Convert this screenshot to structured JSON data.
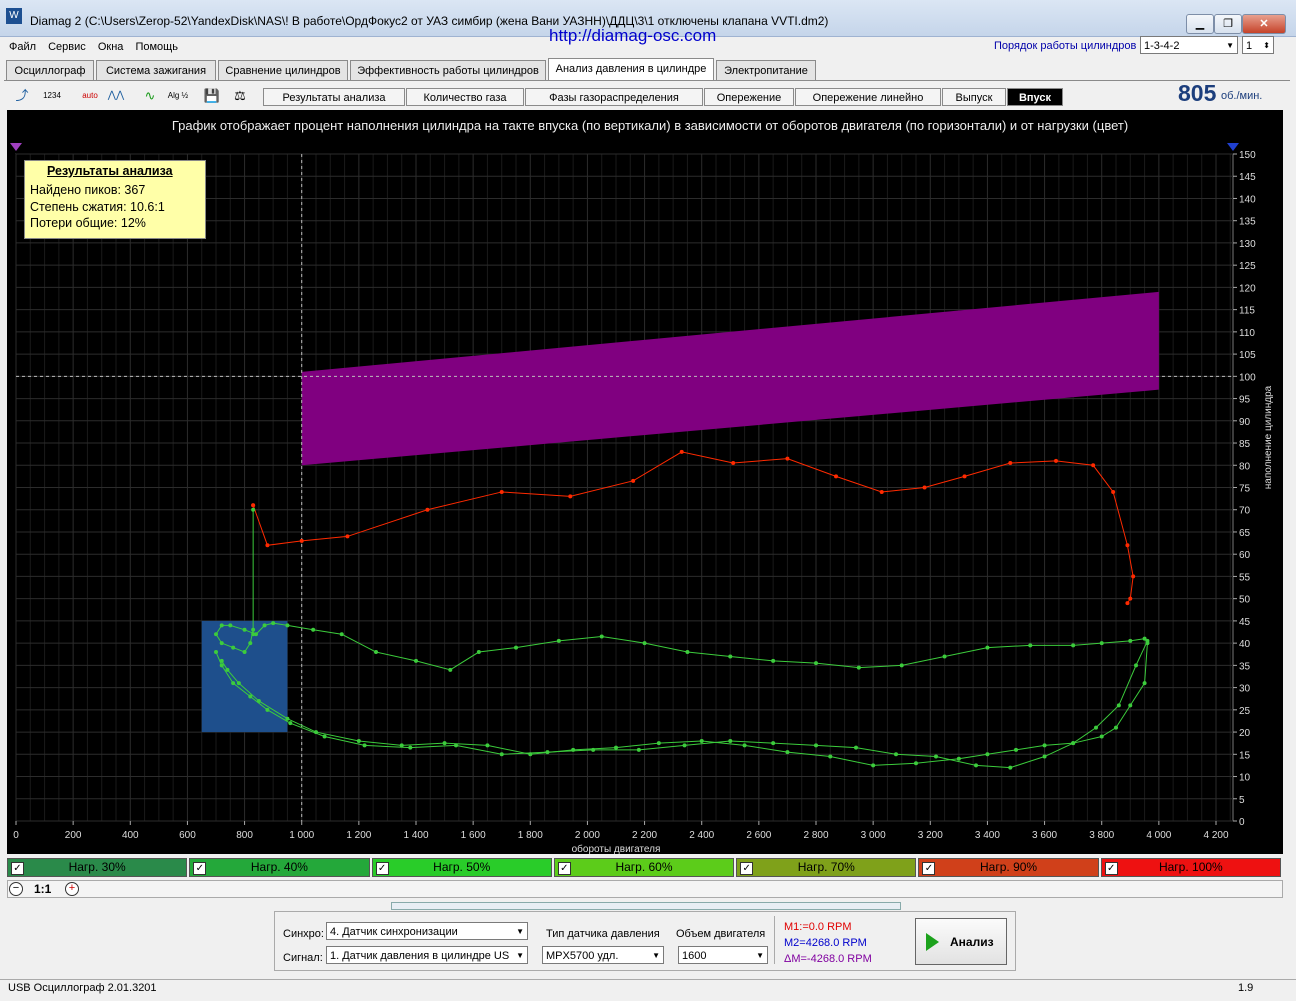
{
  "window": {
    "title": "Diamag 2 (C:\\Users\\Zerop-52\\YandexDisk\\NAS\\! В работе\\ОрдФокус2 от УАЗ симбир (жена Вани УАЗНН)\\ДДЦ\\3\\1 отключены клапана VVTI.dm2)",
    "app_icon": "W",
    "min": "▁",
    "max": "❐",
    "close": "✕"
  },
  "menu": [
    "Файл",
    "Сервис",
    "Окна",
    "Помощь"
  ],
  "site_url": "http://diamag-osc.com",
  "cylinder_order": {
    "label": "Порядок работы цилиндров",
    "value": "1-3-4-2",
    "spin_value": "1"
  },
  "tabs": [
    "Осциллограф",
    "Система зажигания",
    "Сравнение цилиндров",
    "Эффективность работы цилиндров",
    "Анализ давления в цилиндре",
    "Электропитание"
  ],
  "active_tab": "Анализ давления в цилиндре",
  "toolbar_icons": [
    "cursor-icon",
    "counter-icon",
    "auto-icon",
    "waveform-icon",
    "graph-icon",
    "alg-half-icon",
    "save-icon",
    "scale-icon"
  ],
  "toolbar_glyphs": [
    "⤴",
    "1234",
    "auto",
    "⋀⋀",
    "∿",
    "Alg ½",
    "💾",
    "⚖"
  ],
  "subtabs": [
    "Результаты анализа",
    "Количество газа",
    "Фазы газораспределения",
    "Опережение",
    "Опережение линейно",
    "Выпуск",
    "Впуск"
  ],
  "active_subtab": "Впуск",
  "rpm": {
    "value": "805",
    "unit": "об./мин."
  },
  "chart_data": {
    "type": "scatter",
    "title": "График отображает процент наполнения цилиндра на такте впуска (по вертикали) в зависимости от оборотов двигателя (по горизонтали) и от нагрузки (цвет)",
    "xlabel": "обороты двигателя",
    "ylabel": "наполнение цилиндра",
    "xlim": [
      0,
      4400
    ],
    "ylim": [
      0,
      150
    ],
    "x_ticks": [
      "0",
      "200",
      "400",
      "600",
      "800",
      "1 000",
      "1 200",
      "1 400",
      "1 600",
      "1 800",
      "2 000",
      "2 200",
      "2 400",
      "2 600",
      "2 800",
      "3 000",
      "3 200",
      "3 400",
      "3 600",
      "3 800",
      "4 000",
      "4 200"
    ],
    "x_tick_values": [
      0,
      200,
      400,
      600,
      800,
      1000,
      1200,
      1400,
      1600,
      1800,
      2000,
      2200,
      2400,
      2600,
      2800,
      3000,
      3200,
      3400,
      3600,
      3800,
      4000,
      4200
    ],
    "y_ticks": [
      0,
      5,
      10,
      15,
      20,
      25,
      30,
      35,
      40,
      45,
      50,
      55,
      60,
      65,
      70,
      75,
      80,
      85,
      90,
      95,
      100,
      105,
      110,
      115,
      120,
      125,
      130,
      135,
      140,
      145,
      150
    ],
    "reference_line_y": 100,
    "reference_line_x": 1000,
    "norm_band": {
      "x": [
        1000,
        4000
      ],
      "lower": [
        80,
        97
      ],
      "upper": [
        101,
        119
      ],
      "color": "#800080"
    },
    "idle_zone": {
      "x": [
        650,
        950
      ],
      "y": [
        20,
        45
      ],
      "color": "#1e4f8c"
    },
    "series": [
      {
        "color": "#ff2a00",
        "x": [
          830,
          830,
          880,
          1000,
          1160,
          1440,
          1700,
          1940,
          2160,
          2330,
          2510,
          2700,
          2870,
          3030,
          3180,
          3320,
          3480,
          3640,
          3770,
          3840,
          3890,
          3910,
          3900,
          3890
        ],
        "y": [
          71,
          71,
          62,
          63,
          64,
          70,
          74,
          73,
          76.5,
          83,
          80.5,
          81.5,
          77.5,
          74,
          75,
          77.5,
          80.5,
          81,
          80,
          74,
          62,
          55,
          50,
          49
        ]
      },
      {
        "color": "#3ccc3c",
        "x": [
          830,
          820,
          800,
          760,
          720,
          700,
          720,
          750,
          800,
          840,
          870,
          900,
          950,
          1040,
          1140,
          1260,
          1400,
          1520,
          1620,
          1750,
          1900,
          2050,
          2200,
          2350,
          2500,
          2650,
          2800,
          2950,
          3100,
          3250,
          3400,
          3550,
          3700,
          3800,
          3900,
          3950,
          3960,
          3950,
          3900,
          3850,
          3800,
          3700,
          3600,
          3500,
          3400,
          3300,
          3150,
          3000,
          2850,
          2700,
          2550,
          2400,
          2250,
          2100,
          1950,
          1800,
          1650,
          1500,
          1350,
          1200,
          1050,
          950,
          850,
          780,
          740,
          720
        ],
        "y": [
          43,
          40,
          38,
          39,
          40,
          42,
          44,
          44,
          43,
          42,
          44,
          44.5,
          44,
          43,
          42,
          38,
          36,
          34,
          38,
          39,
          40.5,
          41.5,
          40,
          38,
          37,
          36,
          35.5,
          34.5,
          35,
          37,
          39,
          39.5,
          39.5,
          40,
          40.5,
          41,
          40,
          31,
          26,
          21,
          19,
          17.5,
          17,
          16,
          15,
          14,
          13,
          12.5,
          14.5,
          15.5,
          17,
          18,
          17.5,
          16.5,
          16,
          15,
          17,
          17.5,
          17,
          18,
          20,
          23,
          27,
          31,
          34,
          36
        ]
      },
      {
        "color": "#3ccc3c",
        "x": [
          3960,
          3920,
          3860,
          3780,
          3700,
          3600,
          3480,
          3360,
          3220,
          3080,
          2940,
          2800,
          2650,
          2500,
          2340,
          2180,
          2020,
          1860,
          1700,
          1540,
          1380,
          1220,
          1080,
          960,
          880,
          820,
          760,
          720,
          700
        ],
        "y": [
          40.5,
          35,
          26,
          21,
          17.5,
          14.5,
          12,
          12.5,
          14.5,
          15,
          16.5,
          17,
          17.5,
          18,
          17,
          16,
          16,
          15.5,
          15,
          17,
          16.5,
          17,
          19,
          22,
          25,
          28,
          31,
          35,
          38
        ]
      },
      {
        "color": "#3ccc3c",
        "x": [
          830,
          830
        ],
        "y": [
          70,
          42
        ]
      }
    ]
  },
  "results": {
    "title": "Результаты анализа",
    "lines": [
      "Найдено пиков: 367",
      "Степень сжатия: 10.6:1",
      "Потери общие: 12%"
    ]
  },
  "legend": [
    {
      "label": "Нагр. 30%",
      "color": "#2a8a4a"
    },
    {
      "label": "Нагр. 40%",
      "color": "#24a83a"
    },
    {
      "label": "Нагр. 50%",
      "color": "#29cc29"
    },
    {
      "label": "Нагр. 60%",
      "color": "#5ccc1a"
    },
    {
      "label": "Нагр. 70%",
      "color": "#7fa11a"
    },
    {
      "label": "Нагр. 90%",
      "color": "#d0401a"
    },
    {
      "label": "Нагр. 100%",
      "color": "#ee1111"
    }
  ],
  "legend_checkmark": "✓",
  "zoom_label": "1:1",
  "zoom_out": "−",
  "zoom_in": "+",
  "bottom": {
    "sync_label": "Синхро:",
    "sync_value": "4.  Датчик синхронизации",
    "signal_label": "Сигнал:",
    "signal_value": "1.  Датчик давления в цилиндре US",
    "sensor_type_label": "Тип датчика давления",
    "sensor_type_value": "MPX5700 удл.",
    "engine_volume_label": "Объем двигателя",
    "engine_volume_value": "1600",
    "m1": "M1:=0.0 RPM",
    "m2": "M2=4268.0 RPM",
    "dm": "ΔM=-4268.0 RPM",
    "analyze": "Анализ"
  },
  "status": {
    "device": "USB Осциллограф   2.01.3201",
    "right": "1.9"
  }
}
